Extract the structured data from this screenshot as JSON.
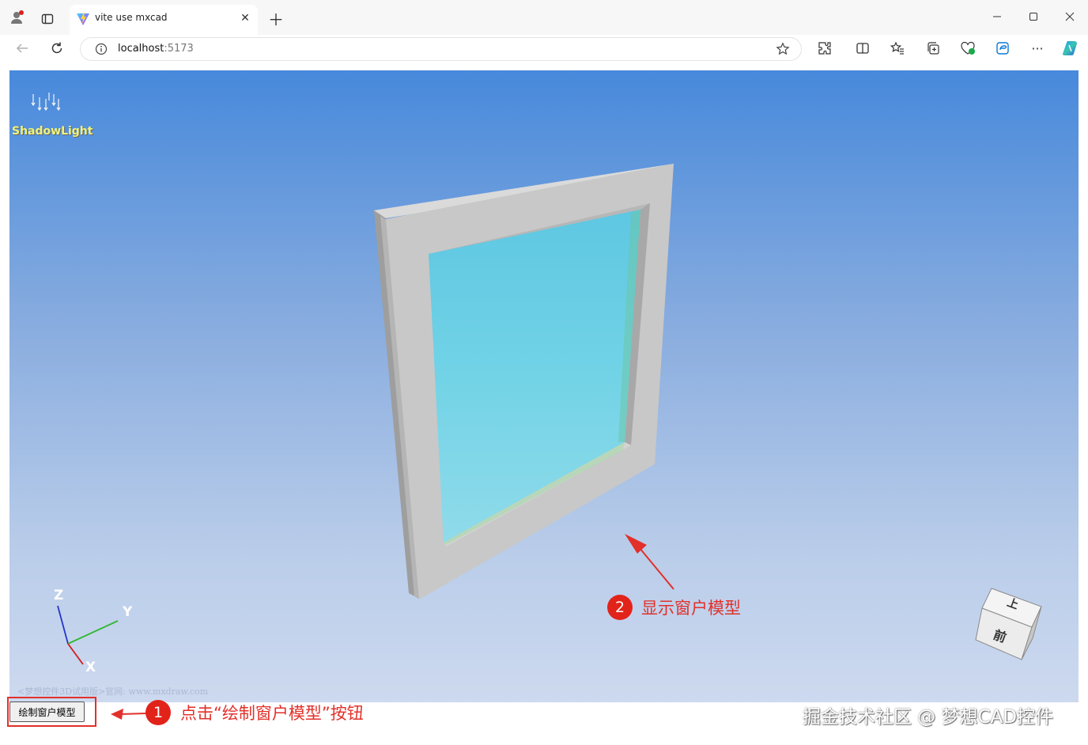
{
  "browser": {
    "tab_title": "vite use mxcad",
    "url_host": "localhost",
    "url_port": ":5173"
  },
  "viewport": {
    "light_label": "ShadowLight",
    "watermark": "<梦想控件3D试用版>官网: www.mxdraw.com",
    "axes": {
      "z": "Z",
      "y": "Y",
      "x": "X"
    },
    "viewcube": {
      "top": "上",
      "front": "前"
    }
  },
  "controls": {
    "draw_window_button": "绘制窗户模型"
  },
  "annotations": {
    "step1_number": "1",
    "step1_text": "点击“绘制窗户模型”按钮",
    "step2_number": "2",
    "step2_text": "显示窗户模型",
    "credit": "掘金技术社区 @ 梦想CAD控件",
    "color": "#e2302a"
  },
  "colors": {
    "sky_top": "#4789db",
    "sky_bottom": "#cdd9ef",
    "frame": "#c8c8c8",
    "glass": "#72d3e6"
  }
}
